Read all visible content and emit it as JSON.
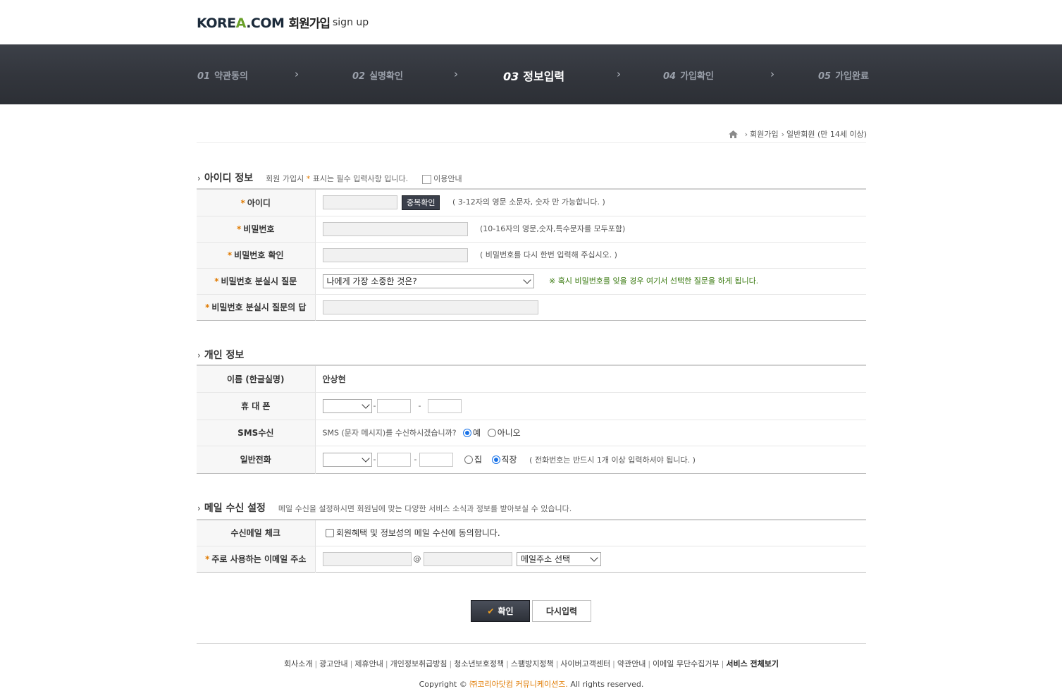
{
  "header": {
    "logo_pre": "KORE",
    "logo_accent": "A",
    "logo_post": ".COM",
    "title_ko": "회원가입",
    "title_en": "sign up"
  },
  "steps": [
    {
      "num": "01",
      "label": "약관동의"
    },
    {
      "num": "02",
      "label": "실명확인"
    },
    {
      "num": "03",
      "label": "정보입력"
    },
    {
      "num": "04",
      "label": "가입확인"
    },
    {
      "num": "05",
      "label": "가입완료"
    }
  ],
  "step_separator": "›",
  "breadcrumb": {
    "sep": "›",
    "items": [
      "회원가입",
      "일반회원 (만 14세 이상)"
    ]
  },
  "section_id": {
    "chevron": "›",
    "title": "아이디 정보",
    "desc_pre": "회원 가입시",
    "desc_star": "*",
    "desc_post": "표시는 필수 입력사항 입니다.",
    "guide_label": "이용안내",
    "rows": {
      "id_label": "아이디",
      "dup_button": "중복확인",
      "id_hint": "( 3-12자의 영문 소문자, 숫자 만 가능합니다. )",
      "pw_label": "비밀번호",
      "pw_hint": "(10-16자의 영문,숫자,특수문자를 모두포함)",
      "pw_confirm_label": "비밀번호 확인",
      "pw_confirm_hint": "( 비밀번호를 다시 한번 입력해 주십시오. )",
      "question_label": "비밀번호 분실시 질문",
      "question_value": "나에게 가장 소중한 것은?",
      "question_hint": "※ 혹시 비밀번호를 잊을 경우 여기서 선택한 질문을 하게 됩니다.",
      "answer_label": "비밀번호 분실시 질문의 답"
    }
  },
  "section_personal": {
    "chevron": "›",
    "title": "개인 정보",
    "rows": {
      "name_label": "이름 (한글실명)",
      "name_value": "안상현",
      "mobile_label": "휴 대 폰",
      "dash": "-",
      "sms_label": "SMS수신",
      "sms_question": "SMS (문자 메시지)를 수신하시겠습니까?",
      "sms_yes": "예",
      "sms_no": "아니오",
      "phone_label": "일반전화",
      "phone_home": "집",
      "phone_work": "직장",
      "phone_hint": "( 전화번호는 반드시 1개 이상 입력하셔야 됩니다. )"
    }
  },
  "section_mail": {
    "chevron": "›",
    "title": "메일 수신 설정",
    "desc": "메일 수신을 설정하시면 회원님에 맞는 다양한 서비스 소식과 정보를 받아보실 수 있습니다.",
    "rows": {
      "check_label": "수신메일 체크",
      "check_text": "회원혜택 및 정보성의 메일 수신에 동의합니다.",
      "email_label": "주로 사용하는 이메일 주소",
      "at": "@",
      "domain_select": "메일주소 선택"
    }
  },
  "required_mark": "*",
  "buttons": {
    "confirm": "확인",
    "reset": "다시입력"
  },
  "footer": {
    "links": [
      "회사소개",
      "광고안내",
      "제휴안내",
      "개인정보취급방침",
      "청소년보호정책",
      "스팸방지정책",
      "사이버고객센터",
      "약관안내",
      "이메일 무단수집거부"
    ],
    "all_services": "서비스 전체보기",
    "copyright_pre": "Copyright ©",
    "copyright_company": "㈜코리아닷컴 커뮤니케이션즈.",
    "copyright_post": "All rights reserved."
  }
}
